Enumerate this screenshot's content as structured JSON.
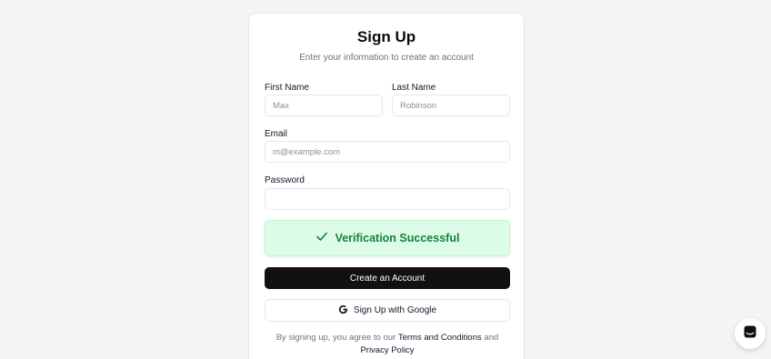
{
  "signup": {
    "title": "Sign Up",
    "subtitle": "Enter your information to create an account",
    "first_name": {
      "label": "First Name",
      "placeholder": "Max"
    },
    "last_name": {
      "label": "Last Name",
      "placeholder": "Robinson"
    },
    "email": {
      "label": "Email",
      "placeholder": "m@example.com"
    },
    "password": {
      "label": "Password",
      "placeholder": ""
    },
    "verification": {
      "text": "Verification Successful",
      "icon": "check-icon"
    },
    "create_button": "Create an Account",
    "google_button": {
      "label": "Sign Up with Google",
      "icon": "google-icon"
    },
    "terms": {
      "prefix": "By signing up, you agree to our",
      "terms_link": "Terms and Conditions",
      "and": "and",
      "privacy_link": "Privacy Policy"
    }
  },
  "chat_widget": {
    "icon": "chat-icon"
  },
  "colors": {
    "page_bg": "#f3f4f6",
    "primary_button": "#111111",
    "success_bg": "#dcfce7",
    "success_text": "#15803d"
  }
}
